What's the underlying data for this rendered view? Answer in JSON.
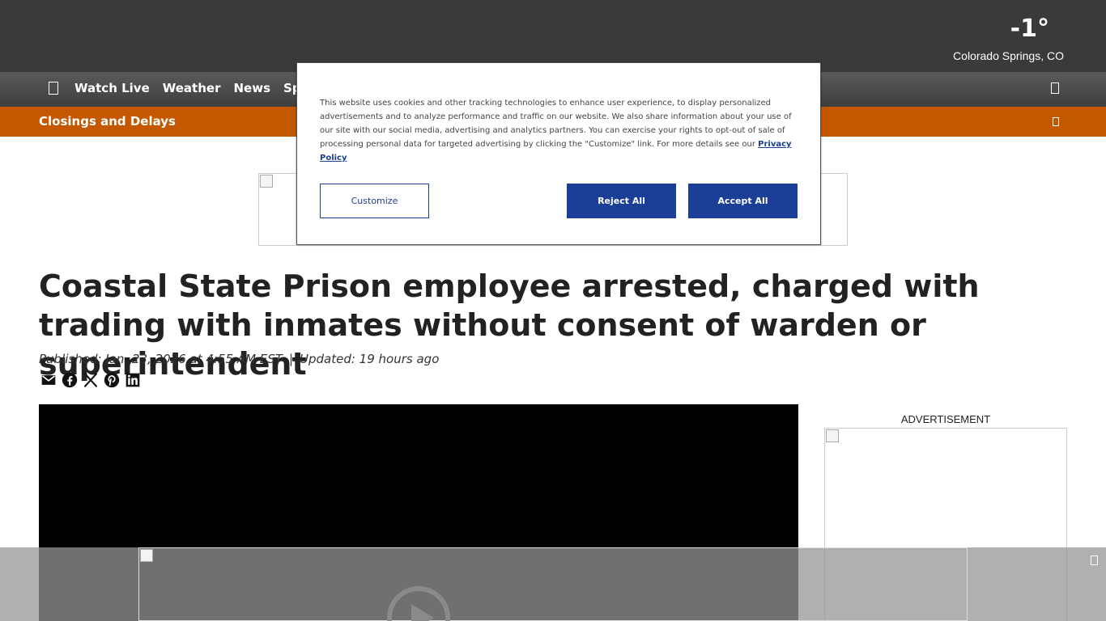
{
  "weather": {
    "temperature": "-1°",
    "location": "Colorado Springs, CO"
  },
  "nav": {
    "items": [
      "Watch Live",
      "Weather",
      "News",
      "Sports"
    ]
  },
  "alert_bar": {
    "label": "Closings and Delays"
  },
  "cookie_banner": {
    "text": "This website uses cookies and other tracking technologies to enhance user experience, to display personalized advertisements and to analyze performance and traffic on our website. We also share information about your use of our site with our social media, advertising and analytics partners. You can exercise your rights to opt-out of sale of processing personal data for targeted advertising by clicking the \"Customize\" link. For more details see our",
    "link_label": "Privacy Policy",
    "customize_label": "Customize",
    "reject_label": "Reject All",
    "accept_label": "Accept All"
  },
  "article": {
    "headline": "Coastal State Prison employee arrested, charged with trading with inmates without consent of warden or superintendent",
    "published": "Published: Jan. 23, 2026 at 4:55 AM EST",
    "separator": "|",
    "updated": "Updated: 19 hours ago",
    "share_icons": [
      "email-icon",
      "facebook-icon",
      "x-icon",
      "pinterest-icon",
      "linkedin-icon"
    ]
  },
  "sidebar": {
    "ad_label": "ADVERTISEMENT"
  },
  "colors": {
    "topbar": "#3a3a3a",
    "alert": "#c45800",
    "button_blue": "#1b3f96"
  }
}
